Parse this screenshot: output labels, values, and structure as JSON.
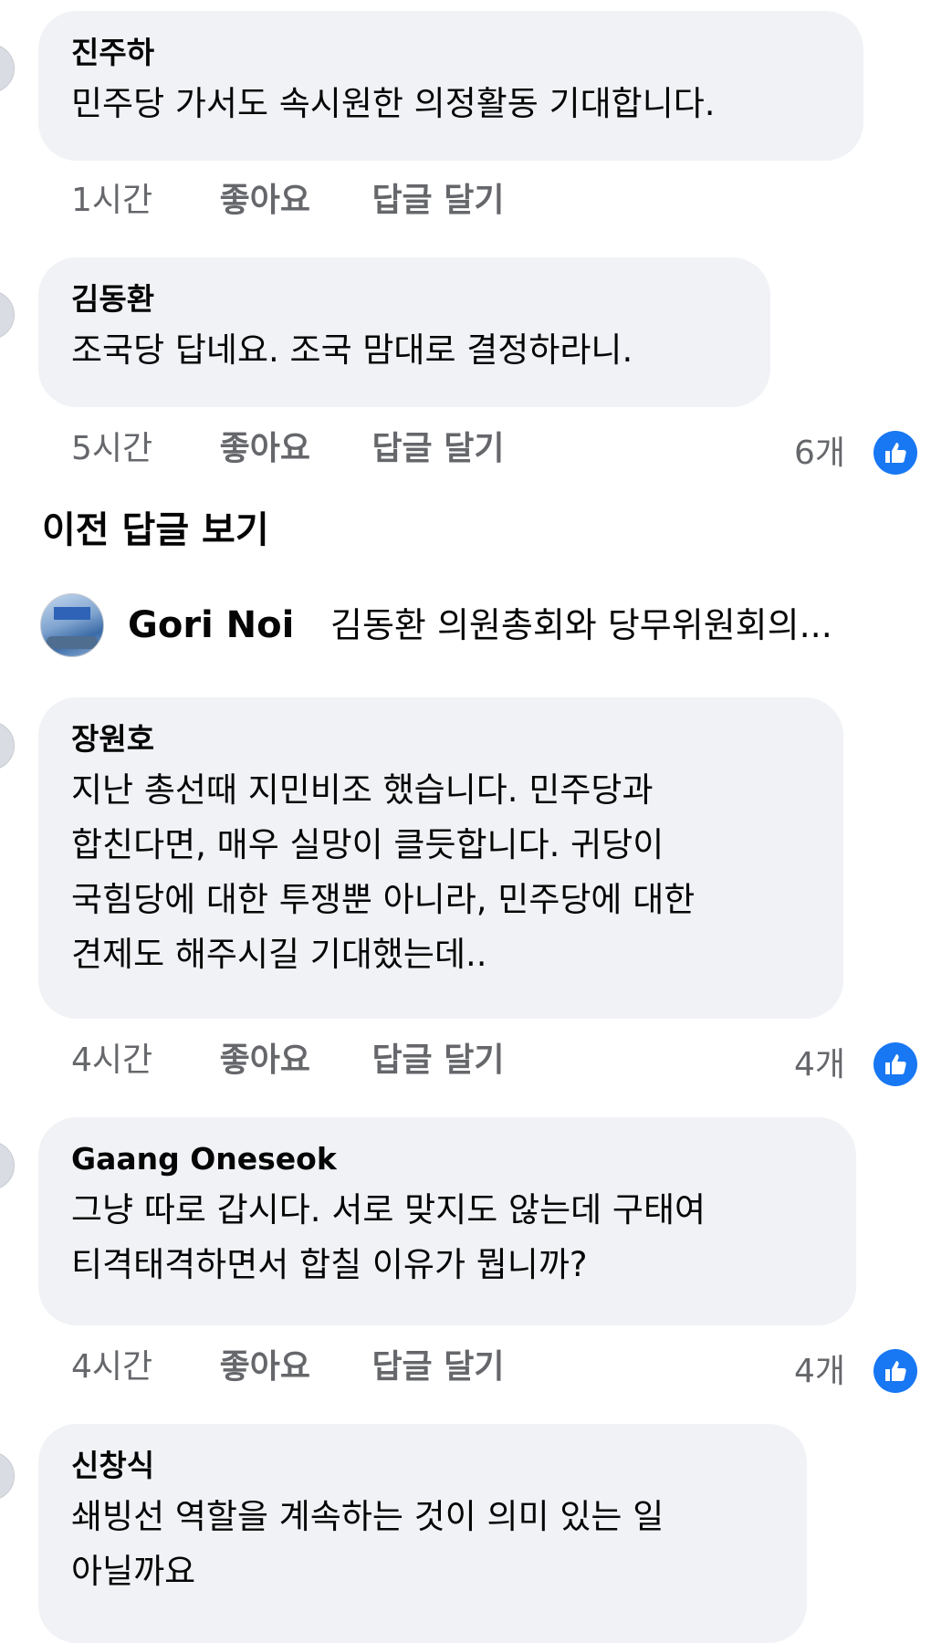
{
  "comments": [
    {
      "author": "진주하",
      "text": "민주당 가서도 속시원한 의정활동 기대합니다.",
      "time": "1시간",
      "like_label": "좋아요",
      "reply_label": "답글 달기"
    },
    {
      "author": "김동환",
      "text": "조국당 답네요. 조국 맘대로 결정하라니.",
      "time": "5시간",
      "like_label": "좋아요",
      "reply_label": "답글 달기",
      "reaction_count": "6개"
    }
  ],
  "view_previous": "이전 답글 보기",
  "shared_post": {
    "name": "Gori Noi",
    "text": "김동환 의원총회와 당무위원회의..."
  },
  "replies": [
    {
      "author": "장원호",
      "text": "지난 총선때 지민비조 했습니다. 민주당과\n합친다면, 매우 실망이 클듯합니다. 귀당이\n국힘당에 대한 투쟁뿐 아니라, 민주당에 대한\n견제도 해주시길 기대했는데..",
      "time": "4시간",
      "like_label": "좋아요",
      "reply_label": "답글 달기",
      "reaction_count": "4개"
    },
    {
      "author": "Gaang Oneseok",
      "text": "그냥 따로 갑시다. 서로 맞지도 않는데 구태여\n티격태격하면서 합칠 이유가 뭡니까?",
      "time": "4시간",
      "like_label": "좋아요",
      "reply_label": "답글 달기",
      "reaction_count": "4개"
    },
    {
      "author": "신창식",
      "text": "쇄빙선 역할을 계속하는 것이 의미 있는 일\n아닐까요"
    }
  ],
  "icons": {
    "reaction": "like-thumbs-up-icon",
    "avatar": "avatar"
  },
  "colors": {
    "bubble": "#f0f2f5",
    "secondary_text": "#65676b",
    "like_blue": "#1877f2"
  }
}
